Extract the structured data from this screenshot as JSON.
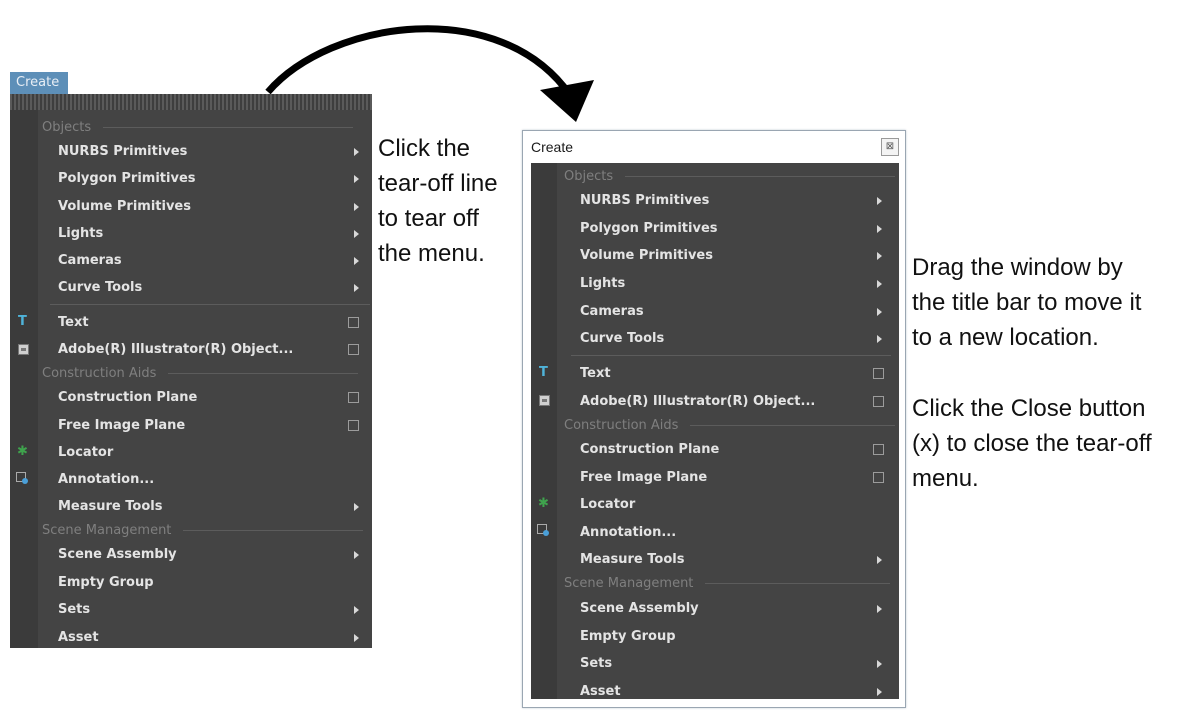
{
  "left_menu": {
    "tab_label": "Create",
    "sections": [
      "Objects",
      "Construction Aids",
      "Scene Management"
    ],
    "items": [
      {
        "label": "NURBS Primitives",
        "submenu": true
      },
      {
        "label": "Polygon Primitives",
        "submenu": true
      },
      {
        "label": "Volume Primitives",
        "submenu": true
      },
      {
        "label": "Lights",
        "submenu": true
      },
      {
        "label": "Cameras",
        "submenu": true
      },
      {
        "label": "Curve Tools",
        "submenu": true
      },
      {
        "label": "Text",
        "option_box": true,
        "icon": "text-icon"
      },
      {
        "label": "Adobe(R) Illustrator(R) Object...",
        "option_box": true,
        "icon": "illustrator-icon"
      },
      {
        "label": "Construction Plane",
        "option_box": true
      },
      {
        "label": "Free Image Plane",
        "option_box": true
      },
      {
        "label": "Locator",
        "icon": "locator-icon"
      },
      {
        "label": "Annotation...",
        "icon": "annotation-icon"
      },
      {
        "label": "Measure Tools",
        "submenu": true
      },
      {
        "label": "Scene Assembly",
        "submenu": true
      },
      {
        "label": "Empty Group"
      },
      {
        "label": "Sets",
        "submenu": true
      },
      {
        "label": "Asset",
        "submenu": true
      }
    ]
  },
  "tearoff_window": {
    "title": "Create",
    "close_symbol": "⊠",
    "sections": [
      "Objects",
      "Construction Aids",
      "Scene Management"
    ],
    "items": [
      "NURBS Primitives",
      "Polygon Primitives",
      "Volume Primitives",
      "Lights",
      "Cameras",
      "Curve Tools",
      "Text",
      "Adobe(R) Illustrator(R) Object...",
      "Construction Plane",
      "Free Image Plane",
      "Locator",
      "Annotation...",
      "Measure Tools",
      "Scene Assembly",
      "Empty Group",
      "Sets",
      "Asset"
    ]
  },
  "notes": {
    "tearoff": [
      "Click the",
      "tear-off line",
      "to tear off",
      "the menu."
    ],
    "drag": [
      "Drag the window by",
      "the title bar to move it",
      "to a new location."
    ],
    "close": [
      "Click the Close button",
      "(x) to close the tear-off",
      "menu."
    ]
  },
  "colors": {
    "menu_bg": "#444444",
    "gutter": "#3b3b3b",
    "tab_blue": "#5d8fb8",
    "text_icon": "#4fb3d9",
    "locator_icon": "#3fa34d"
  }
}
